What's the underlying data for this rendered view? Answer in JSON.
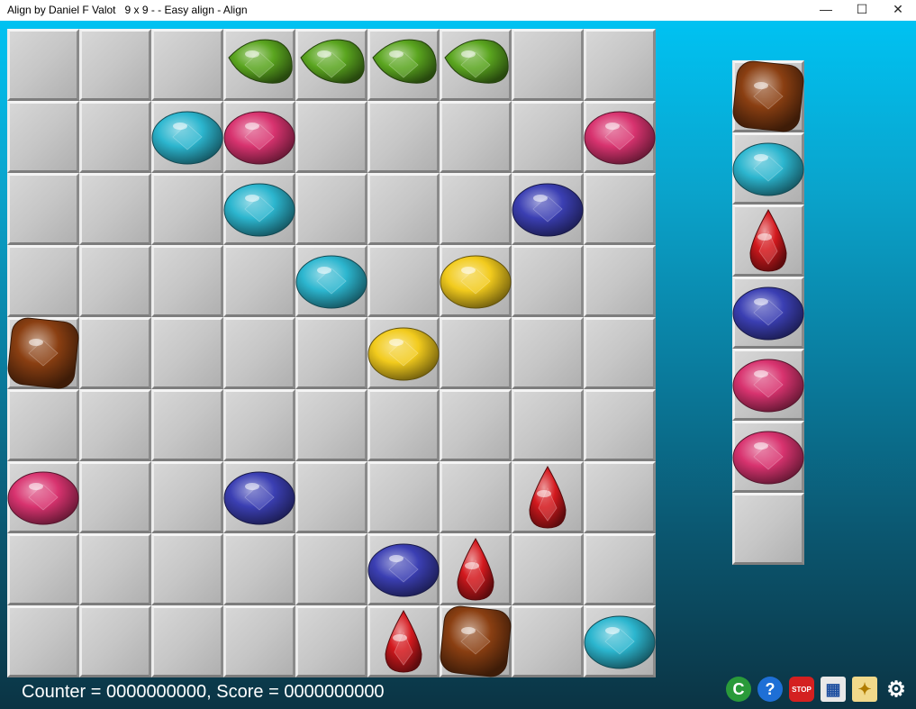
{
  "window": {
    "title": "Align by Daniel F Valot   9 x 9 - - Easy align - Align",
    "minimize_glyph": "—",
    "maximize_glyph": "☐",
    "close_glyph": "✕"
  },
  "colors": {
    "green": "#5aa51f",
    "cyan": "#2cb6cf",
    "pink": "#d8336f",
    "blue": "#3b3fb3",
    "yellow": "#f2cb1d",
    "brown": "#8a3f12",
    "red": "#d4191e"
  },
  "board": {
    "size": "9 x 9",
    "rows": [
      [
        "",
        "",
        "",
        "green",
        "green",
        "green",
        "green",
        "",
        ""
      ],
      [
        "",
        "",
        "cyan",
        "pink",
        "",
        "",
        "",
        "",
        "pink"
      ],
      [
        "",
        "",
        "",
        "cyan",
        "",
        "",
        "",
        "blue",
        ""
      ],
      [
        "",
        "",
        "",
        "",
        "cyan",
        "",
        "yellow",
        "",
        ""
      ],
      [
        "brown",
        "",
        "",
        "",
        "",
        "yellow",
        "",
        "",
        ""
      ],
      [
        "",
        "",
        "",
        "",
        "",
        "",
        "",
        "",
        ""
      ],
      [
        "pink",
        "",
        "",
        "blue",
        "",
        "",
        "",
        "red",
        ""
      ],
      [
        "",
        "",
        "",
        "",
        "",
        "blue",
        "red",
        "",
        ""
      ],
      [
        "",
        "",
        "",
        "",
        "",
        "red",
        "brown",
        "",
        "cyan"
      ]
    ]
  },
  "next_queue": [
    "brown",
    "cyan",
    "red",
    "blue",
    "pink",
    "pink",
    ""
  ],
  "status": {
    "text": "Counter = 0000000000, Score = 0000000000"
  },
  "toolbar": [
    {
      "name": "copyright-icon",
      "glyph": "C",
      "bg": "#2a9a3a"
    },
    {
      "name": "help-icon",
      "glyph": "?",
      "bg": "#1e6fd6"
    },
    {
      "name": "stop-icon",
      "glyph": "STOP",
      "bg": "#d42020"
    },
    {
      "name": "calculator-icon",
      "glyph": "▦",
      "bg": "#e8e8e8"
    },
    {
      "name": "tag-icon",
      "glyph": "✦",
      "bg": "#f1d98a"
    },
    {
      "name": "gear-icon",
      "glyph": "⚙",
      "bg": "transparent"
    }
  ]
}
